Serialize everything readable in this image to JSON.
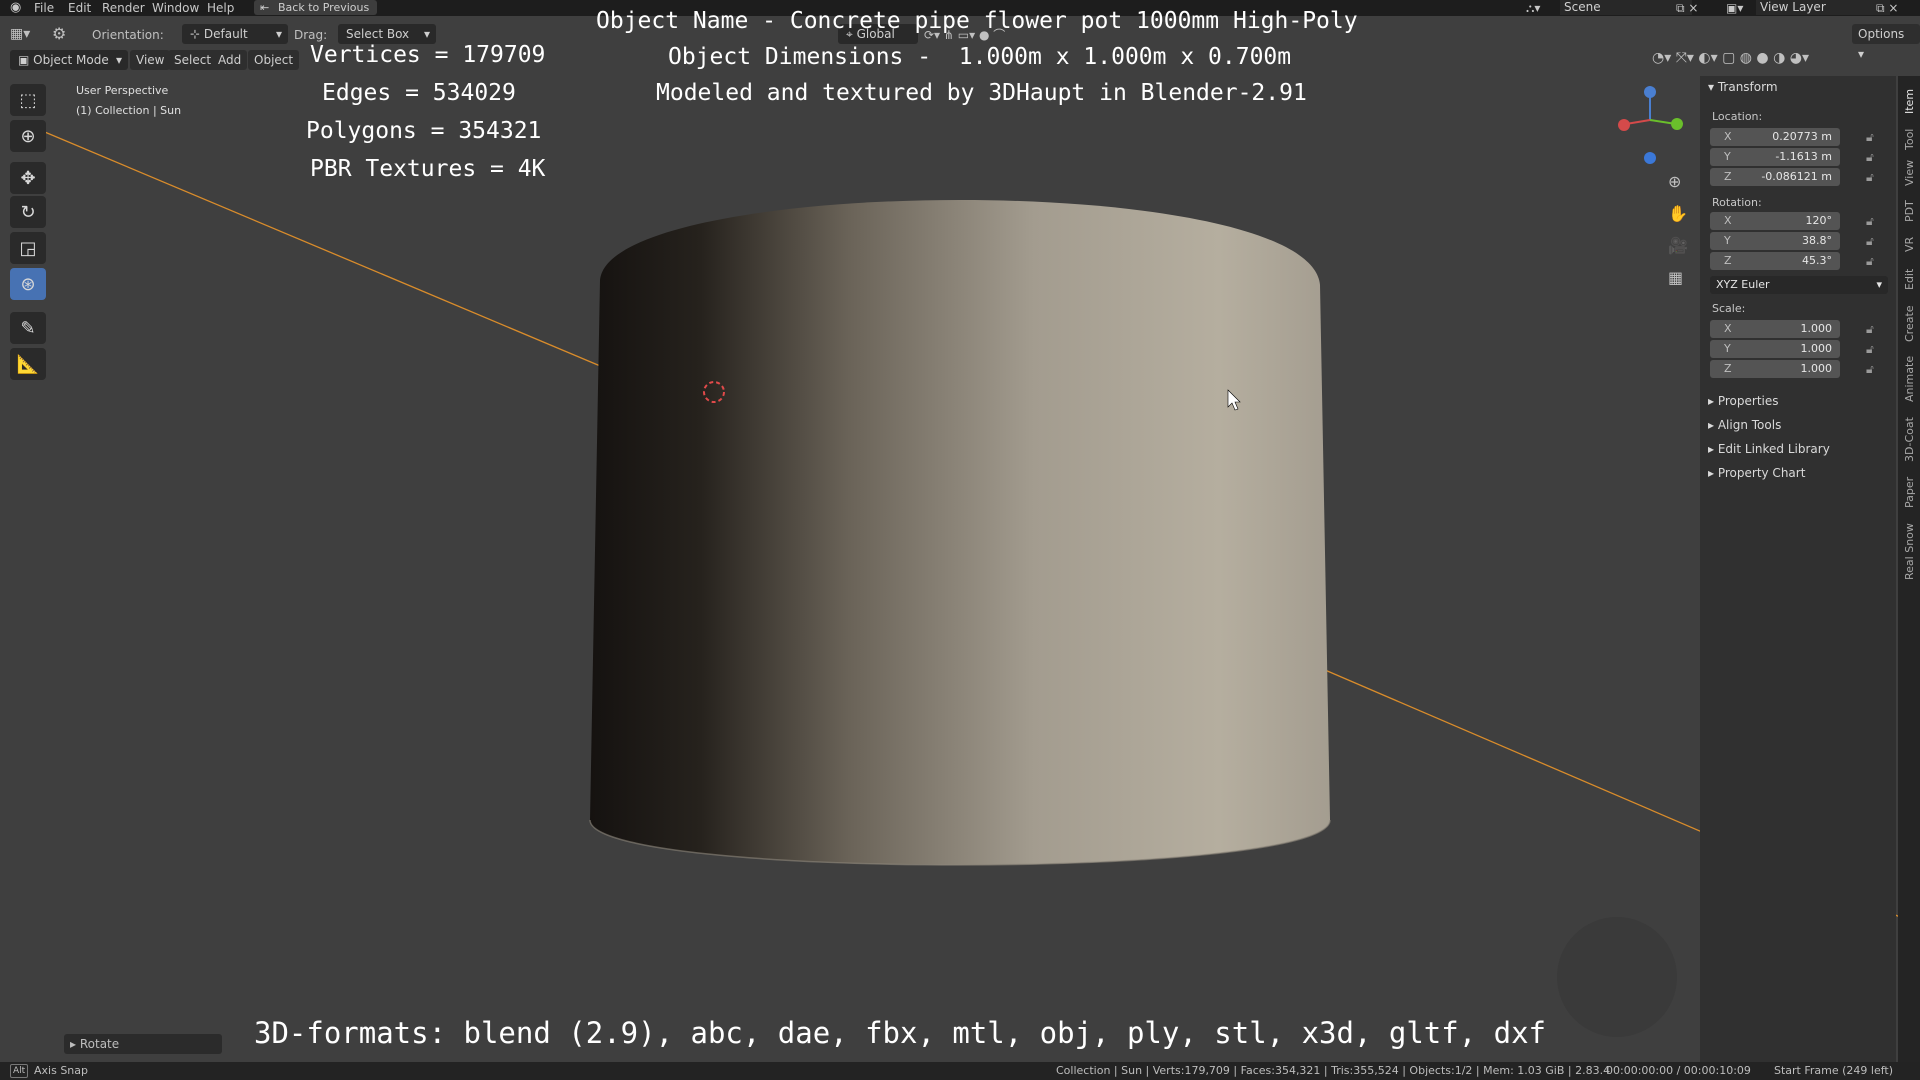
{
  "menu": [
    "File",
    "Edit",
    "Render",
    "Window",
    "Help"
  ],
  "back_button": "Back to Previous",
  "scene": "Scene",
  "view_layer": "View Layer",
  "header": {
    "orientation_label": "Orientation:",
    "orientation_value": "Default",
    "drag_label": "Drag:",
    "drag_value": "Select Box",
    "mode": "Object Mode",
    "view": "View",
    "select": "Select",
    "add": "Add",
    "object": "Object",
    "transform_orientation": "Global",
    "options": "Options"
  },
  "viewport": {
    "perspective": "User Perspective",
    "collection": "(1) Collection | Sun"
  },
  "overlay": {
    "title": "Object Name - Concrete pipe flower pot 1000mm High-Poly",
    "dimensions": "Object Dimensions -  1.000m x 1.000m x 0.700m",
    "credit": "Modeled and textured by 3DHaupt in Blender-2.91",
    "vertices": "Vertices = 179709",
    "edges": "Edges = 534029",
    "polygons": "Polygons = 354321",
    "textures": "PBR Textures = 4K",
    "formats": "3D-formats: blend (2.9), abc, dae, fbx, mtl, obj, ply, stl, x3d, gltf, dxf"
  },
  "panel": {
    "transform": "Transform",
    "location_label": "Location:",
    "location": [
      {
        "axis": "X",
        "value": "0.20773 m"
      },
      {
        "axis": "Y",
        "value": "-1.1613 m"
      },
      {
        "axis": "Z",
        "value": "-0.086121 m"
      }
    ],
    "rotation_label": "Rotation:",
    "rotation": [
      {
        "axis": "X",
        "value": "120°"
      },
      {
        "axis": "Y",
        "value": "38.8°"
      },
      {
        "axis": "Z",
        "value": "45.3°"
      }
    ],
    "rotation_mode": "XYZ Euler",
    "scale_label": "Scale:",
    "scale": [
      {
        "axis": "X",
        "value": "1.000"
      },
      {
        "axis": "Y",
        "value": "1.000"
      },
      {
        "axis": "Z",
        "value": "1.000"
      }
    ],
    "subpanels": [
      "Properties",
      "Align Tools",
      "Edit Linked Library",
      "Property Chart"
    ]
  },
  "vtabs": [
    "Item",
    "Tool",
    "View",
    "PDT",
    "VR",
    "Edit",
    "Create",
    "Animate",
    "3D-Coat",
    "Paper",
    "Real Snow"
  ],
  "last_op": "Rotate",
  "status": {
    "left": "Axis Snap",
    "right": "Collection | Sun | Verts:179,709 | Faces:354,321 | Tris:355,524 | Objects:1/2 | Mem: 1.03 GiB | 2.83.4",
    "time": "00:00:00:00 / 00:00:10:09",
    "frame": "Start Frame (249 left)"
  },
  "colors": {
    "accent": "#4772b3",
    "object_line": "#d98c2b"
  }
}
